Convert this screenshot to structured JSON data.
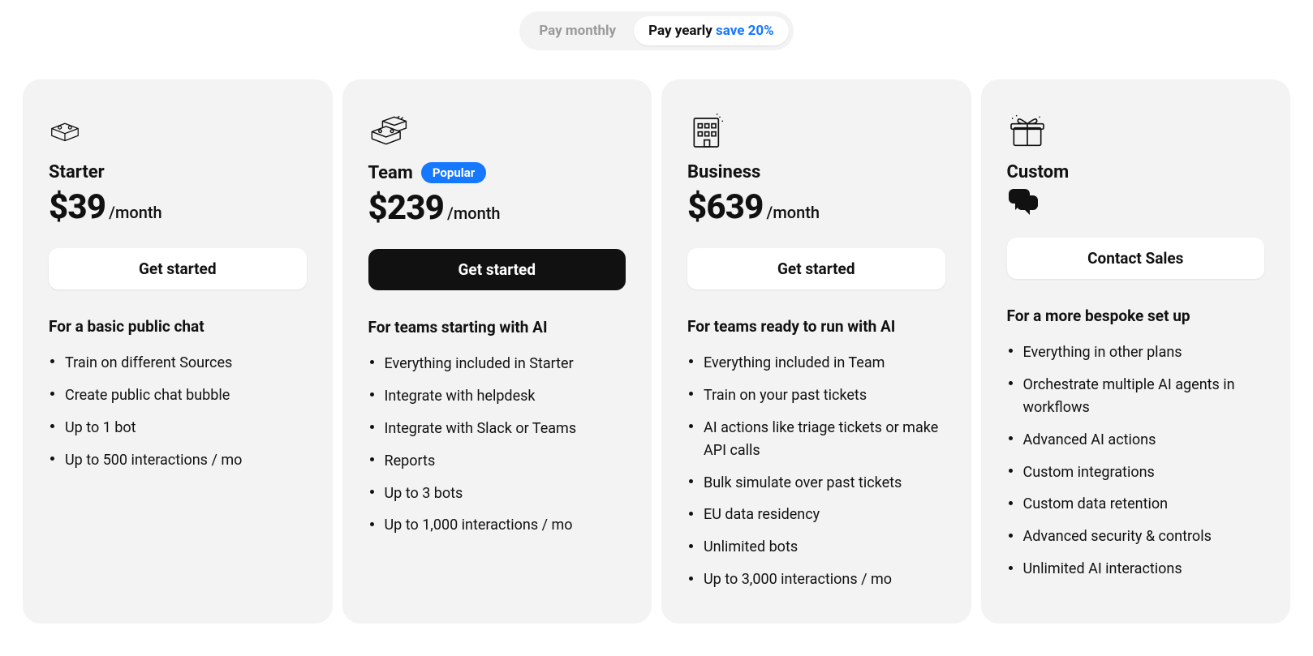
{
  "toggle": {
    "monthly_label": "Pay monthly",
    "yearly_label": "Pay yearly ",
    "yearly_save": "save 20%",
    "active": "yearly"
  },
  "plans": [
    {
      "key": "starter",
      "name": "Starter",
      "price": "$39",
      "period": "/month",
      "cta": "Get started",
      "cta_style": "light",
      "subhead": "For a basic public chat",
      "badge": null,
      "icon": "block-icon",
      "features": [
        "Train on different Sources",
        "Create public chat bubble",
        "Up to 1 bot",
        "Up to 500 interactions / mo"
      ]
    },
    {
      "key": "team",
      "name": "Team",
      "price": "$239",
      "period": "/month",
      "cta": "Get started",
      "cta_style": "dark",
      "subhead": "For teams starting with AI",
      "badge": "Popular",
      "icon": "blocks-icon",
      "features": [
        "Everything included in Starter",
        "Integrate with helpdesk",
        "Integrate with Slack or Teams",
        "Reports",
        "Up to 3 bots",
        "Up to 1,000 interactions / mo"
      ]
    },
    {
      "key": "business",
      "name": "Business",
      "price": "$639",
      "period": "/month",
      "cta": "Get started",
      "cta_style": "light",
      "subhead": "For teams ready to run with AI",
      "badge": null,
      "icon": "building-icon",
      "features": [
        "Everything included in Team",
        "Train on your past tickets",
        "AI actions like triage tickets or make API calls",
        "Bulk simulate over past tickets",
        "EU data residency",
        "Unlimited bots",
        "Up to 3,000 interactions / mo"
      ]
    },
    {
      "key": "custom",
      "name": "Custom",
      "price": null,
      "period": null,
      "cta": "Contact Sales",
      "cta_style": "light",
      "subhead": "For a more bespoke set up",
      "badge": null,
      "icon": "gift-icon",
      "features": [
        "Everything in other plans",
        "Orchestrate multiple AI agents in workflows",
        "Advanced AI actions",
        "Custom integrations",
        "Custom data retention",
        "Advanced security & controls",
        "Unlimited AI interactions"
      ]
    }
  ]
}
